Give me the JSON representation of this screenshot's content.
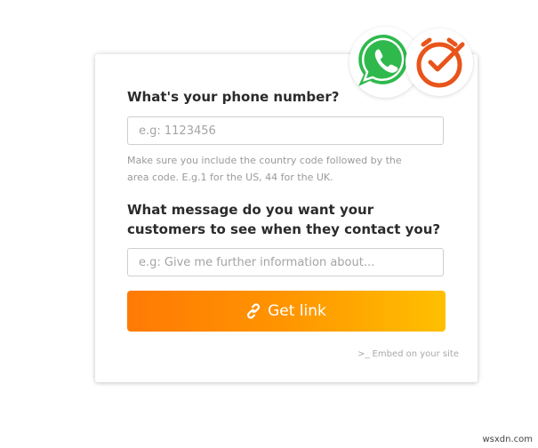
{
  "form": {
    "phone_question": "What's your phone number?",
    "phone_placeholder": "e.g: 1123456",
    "phone_value": "",
    "hint_line1": "Make sure you include the country code followed by the",
    "hint_line2": "area code. E.g.1 for the US, 44 for the UK.",
    "message_question_line1": "What message do you want your",
    "message_question_line2": "customers to see when they contact you?",
    "message_placeholder": "e.g: Give me further information about...",
    "message_value": "",
    "get_link_label": "Get link",
    "embed_label": "Embed on your site"
  },
  "logos": {
    "left_icon": "whatsapp-icon",
    "right_icon": "clock-check-icon"
  },
  "colors": {
    "whatsapp_green": "#2fb94d",
    "clock_orange": "#e8541a",
    "button_gradient_start": "#ff7a05",
    "button_gradient_end": "#ffc000"
  },
  "watermark": "wsxdn.com"
}
